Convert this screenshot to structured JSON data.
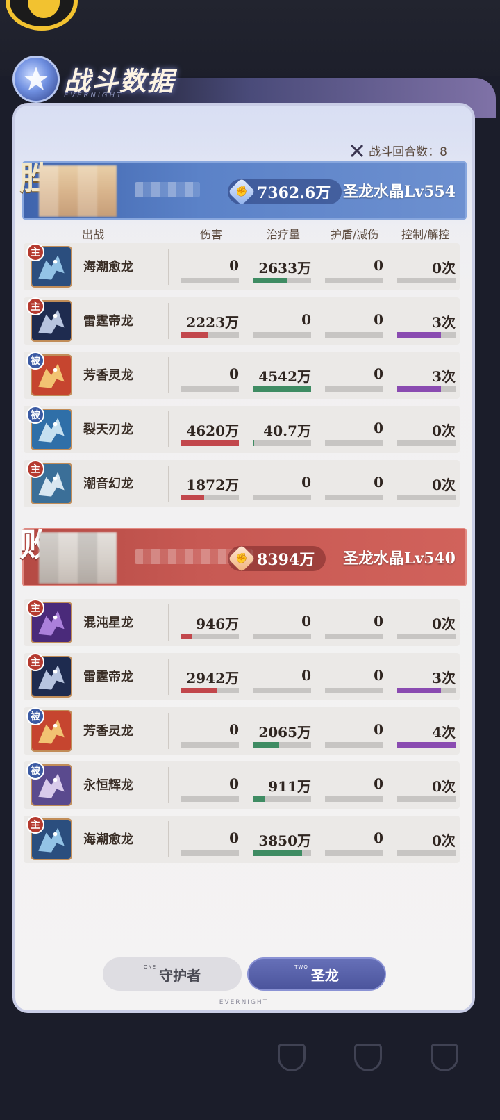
{
  "header": {
    "title": "战斗数据",
    "subtitle": "EVERNIGHT"
  },
  "round_count": "战斗回合数：8",
  "columns": {
    "name": "出战",
    "damage": "伤害",
    "heal": "治疗量",
    "shield": "护盾/减伤",
    "control": "控制/解控"
  },
  "team_top": {
    "letter": "胜",
    "power": "7362.6万",
    "crystal_level": "圣龙水晶Lv554",
    "rows": [
      {
        "role": "主",
        "name": "海潮愈龙",
        "damage": "0",
        "heal": "2633万",
        "shield": "0",
        "control": "0次",
        "damage_pct": 0,
        "heal_pct": 58,
        "shield_pct": 0,
        "control_pct": 0
      },
      {
        "role": "主",
        "name": "雷霆帝龙",
        "damage": "2223万",
        "heal": "0",
        "shield": "0",
        "control": "3次",
        "damage_pct": 48,
        "heal_pct": 0,
        "shield_pct": 0,
        "control_pct": 75
      },
      {
        "role": "被",
        "name": "芳香灵龙",
        "damage": "0",
        "heal": "4542万",
        "shield": "0",
        "control": "3次",
        "damage_pct": 0,
        "heal_pct": 100,
        "shield_pct": 0,
        "control_pct": 75
      },
      {
        "role": "被",
        "name": "裂天刃龙",
        "damage": "4620万",
        "heal": "40.7万",
        "shield": "0",
        "control": "0次",
        "damage_pct": 100,
        "heal_pct": 2,
        "shield_pct": 0,
        "control_pct": 0
      },
      {
        "role": "主",
        "name": "潮音幻龙",
        "damage": "1872万",
        "heal": "0",
        "shield": "0",
        "control": "0次",
        "damage_pct": 40,
        "heal_pct": 0,
        "shield_pct": 0,
        "control_pct": 0
      }
    ]
  },
  "team_bottom": {
    "letter": "败",
    "power": "8394万",
    "crystal_level": "圣龙水晶Lv540",
    "rows": [
      {
        "role": "主",
        "name": "混沌星龙",
        "damage": "946万",
        "heal": "0",
        "shield": "0",
        "control": "0次",
        "damage_pct": 20,
        "heal_pct": 0,
        "shield_pct": 0,
        "control_pct": 0
      },
      {
        "role": "主",
        "name": "雷霆帝龙",
        "damage": "2942万",
        "heal": "0",
        "shield": "0",
        "control": "3次",
        "damage_pct": 63,
        "heal_pct": 0,
        "shield_pct": 0,
        "control_pct": 75
      },
      {
        "role": "被",
        "name": "芳香灵龙",
        "damage": "0",
        "heal": "2065万",
        "shield": "0",
        "control": "4次",
        "damage_pct": 0,
        "heal_pct": 45,
        "shield_pct": 0,
        "control_pct": 100
      },
      {
        "role": "被",
        "name": "永恒辉龙",
        "damage": "0",
        "heal": "911万",
        "shield": "0",
        "control": "0次",
        "damage_pct": 0,
        "heal_pct": 20,
        "shield_pct": 0,
        "control_pct": 0
      },
      {
        "role": "主",
        "name": "海潮愈龙",
        "damage": "0",
        "heal": "3850万",
        "shield": "0",
        "control": "0次",
        "damage_pct": 0,
        "heal_pct": 84,
        "shield_pct": 0,
        "control_pct": 0
      }
    ]
  },
  "tabs": [
    {
      "sup": "ONE",
      "label": "守护者",
      "active": false
    },
    {
      "sup": "TWO",
      "label": "圣龙",
      "active": true
    }
  ],
  "footer_brand": "EVERNIGHT",
  "colors": {
    "damage": "#c2474c",
    "heal": "#3f8c63",
    "control": "#8a4bb1",
    "team_top": "#5b82c8",
    "team_bottom": "#c75953"
  }
}
